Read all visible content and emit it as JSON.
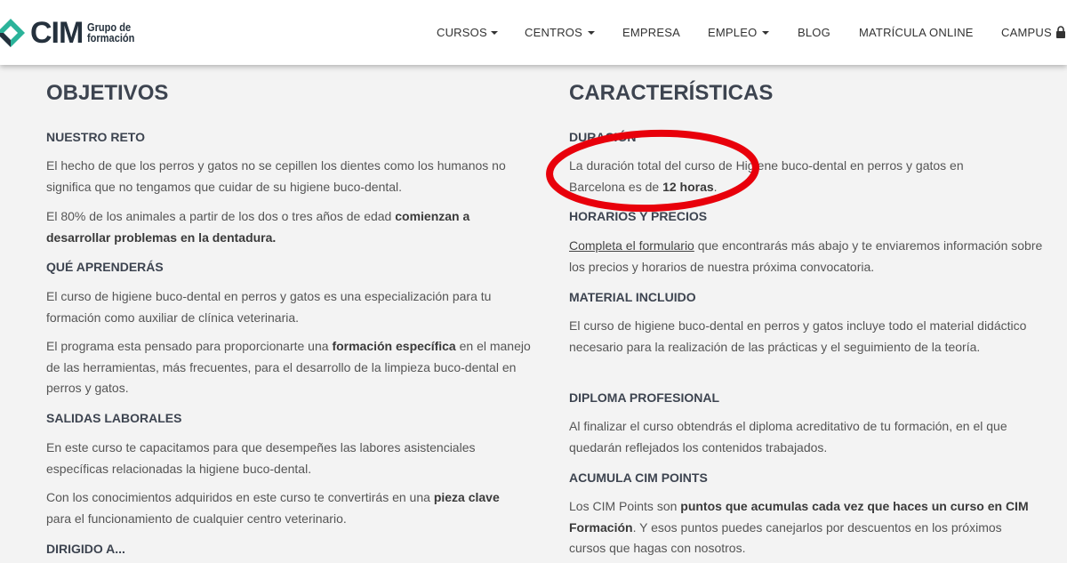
{
  "header": {
    "logo": {
      "brand": "CIM",
      "sub_line1": "Grupo de",
      "sub_line2": "formación"
    },
    "nav": [
      {
        "label": "CURSOS",
        "dropdown": true
      },
      {
        "label": "CENTROS",
        "dropdown": true
      },
      {
        "label": "EMPRESA",
        "dropdown": false
      },
      {
        "label": "EMPLEO",
        "dropdown": true
      },
      {
        "label": "BLOG",
        "dropdown": false
      },
      {
        "label": "MATRÍCULA ONLINE",
        "dropdown": false
      },
      {
        "label": "CAMPUS",
        "dropdown": false,
        "icon": "lock-icon"
      }
    ]
  },
  "objetivos": {
    "title": "OBJETIVOS",
    "reto_heading": "NUESTRO RETO",
    "reto_p1": "El hecho de que los perros y gatos no se cepillen los dientes como los humanos no significa que no tengamos que cuidar de su higiene buco-dental.",
    "reto_p2_pre": "El 80% de los animales a partir de los dos o tres años de edad ",
    "reto_p2_bold": "comienzan a desarrollar problemas en la dentadura.",
    "aprenderas_heading": "QUÉ APRENDERÁS",
    "aprenderas_p1": "El curso de higiene buco-dental en perros y gatos es una especialización para tu formación como auxiliar de clínica veterinaria.",
    "aprenderas_p2_pre": "El programa esta pensado para proporcionarte una ",
    "aprenderas_p2_bold": "formación específica",
    "aprenderas_p2_post": " en el manejo de las herramientas, más frecuentes, para el desarrollo de la limpieza buco-dental en perros y gatos.",
    "salidas_heading": "SALIDAS LABORALES",
    "salidas_p1": "En este curso te capacitamos para que desempeñes las labores asistenciales específicas relacionadas la higiene buco-dental.",
    "salidas_p2_pre": "Con los conocimientos adquiridos en este curso te convertirás en una ",
    "salidas_p2_bold": "pieza clave",
    "salidas_p2_post": " para el funcionamiento de cualquier centro veterinario.",
    "dirigido_heading": "DIRIGIDO A..."
  },
  "caracteristicas": {
    "title": "CARACTERÍSTICAS",
    "duracion_heading": "DURACIÓN",
    "duracion_pre": "La duración total del curso de Higiene buco-dental en perros y gatos en Barcelona es de ",
    "duracion_bold": "12 horas",
    "duracion_post": ".",
    "horarios_heading": "HORARIOS Y PRECIOS",
    "horarios_link": "Completa el formulario",
    "horarios_post": " que encontrarás más abajo y te enviaremos información sobre los precios y horarios de nuestra próxima convocatoria.",
    "material_heading": "MATERIAL INCLUIDO",
    "material_p": "El curso de higiene buco-dental en perros y gatos incluye todo el material didáctico necesario para la realización de las prácticas y el seguimiento de la teoría.",
    "diploma_heading": "DIPLOMA PROFESIONAL",
    "diploma_p": "Al finalizar el curso obtendrás el diploma acreditativo de tu formación, en el que quedarán reflejados los contenidos trabajados.",
    "points_heading": "ACUMULA CIM POINTS",
    "points_pre": "Los CIM Points son ",
    "points_bold": "puntos que acumulas cada vez que haces un curso en CIM Formación",
    "points_post": ". Y esos puntos puedes canejarlos por descuentos en los próximos cursos que hagas con nosotros."
  },
  "annotation": {
    "color": "#e8000b"
  },
  "colors": {
    "brand_dark": "#25313d",
    "brand_accent": "#2bb39a",
    "background": "#f3f3f3"
  }
}
